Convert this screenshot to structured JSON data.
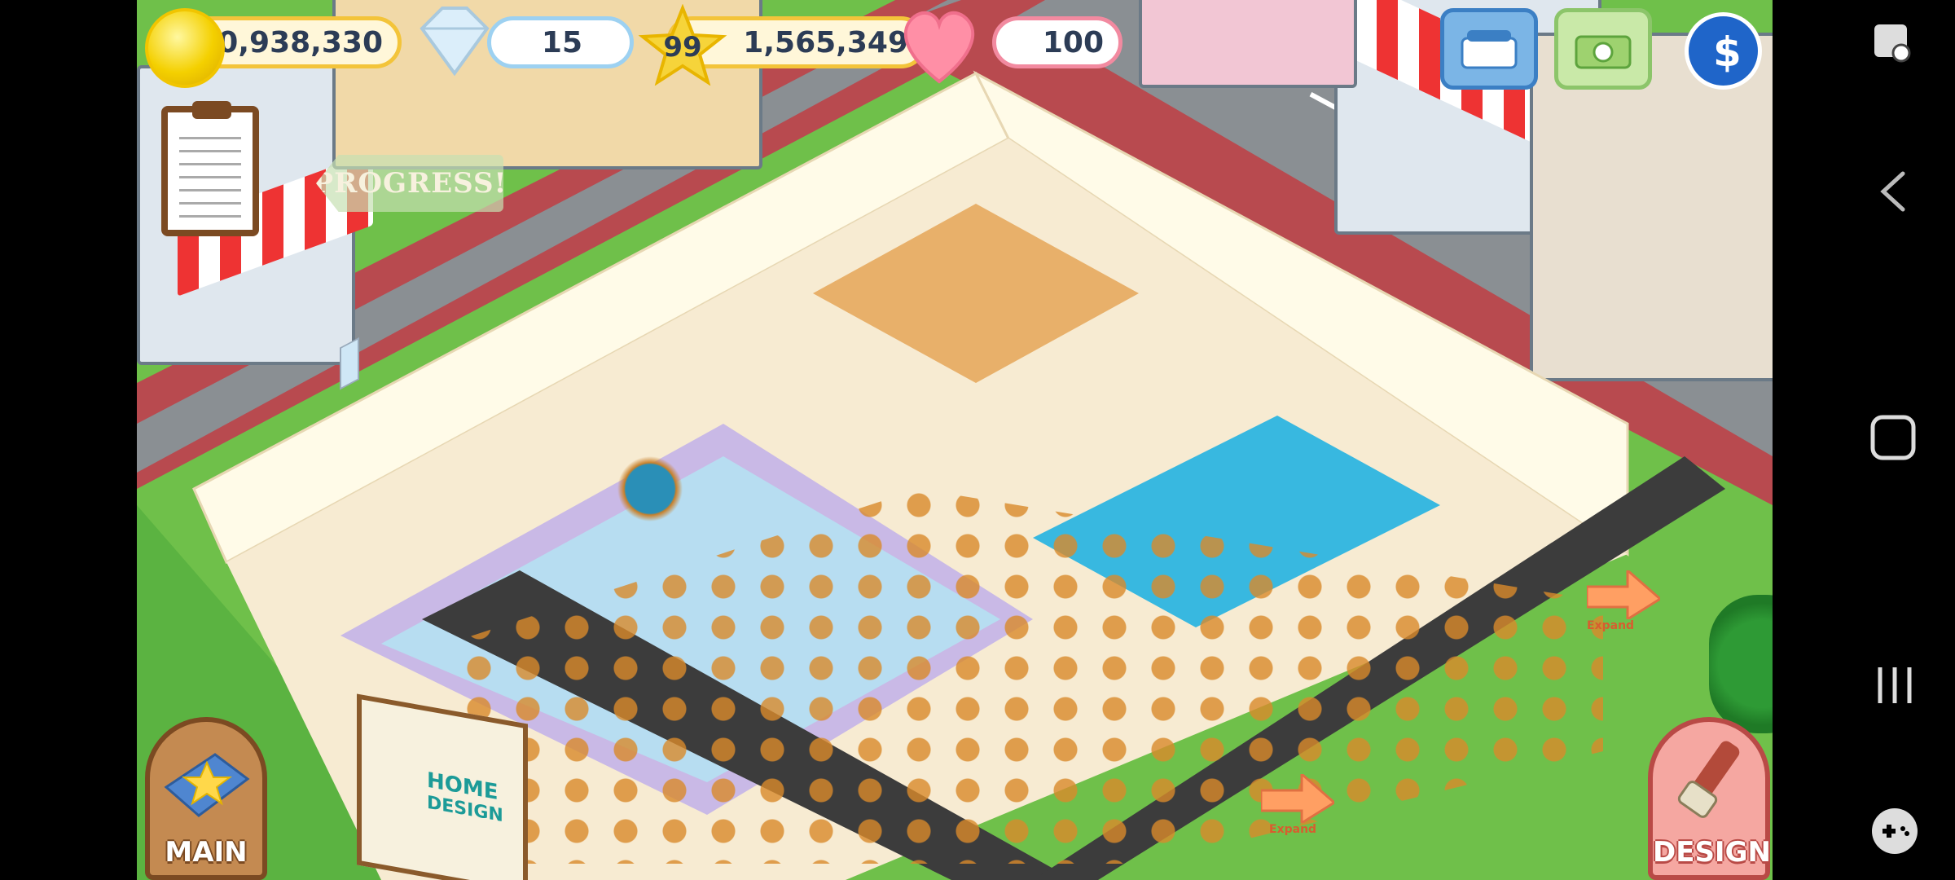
{
  "hud": {
    "coins": "40,938,330",
    "gems": "15",
    "level": "99",
    "xp": "1,565,349",
    "hearts": "100"
  },
  "progress_label": "PROGRESS!",
  "buttons": {
    "main_label": "MAIN",
    "design_label": "DESIGN"
  },
  "expand_labels": [
    "Expand",
    "Expand"
  ],
  "billboard": {
    "line1": "HOME",
    "line2": "DESIGN"
  },
  "colors": {
    "gold": "#f3c43a",
    "grass": "#6fc04a",
    "street": "#8a8f93",
    "sidewalk": "#b84a4f",
    "floor_blue": "#38b8e0",
    "wall": "#fffbe8"
  },
  "icons": {
    "coin": "coin-icon",
    "gem": "diamond-icon",
    "star": "star-icon",
    "heart": "heart-icon",
    "phone": "phone-icon",
    "camera": "camera-icon",
    "social": "social-s-icon",
    "clipboard": "clipboard-icon"
  },
  "nav": {
    "back": "back-icon",
    "home": "home-icon",
    "recents": "recents-icon",
    "game": "gamepad-icon",
    "screenshot_tool": "screenshot-tool-icon"
  }
}
